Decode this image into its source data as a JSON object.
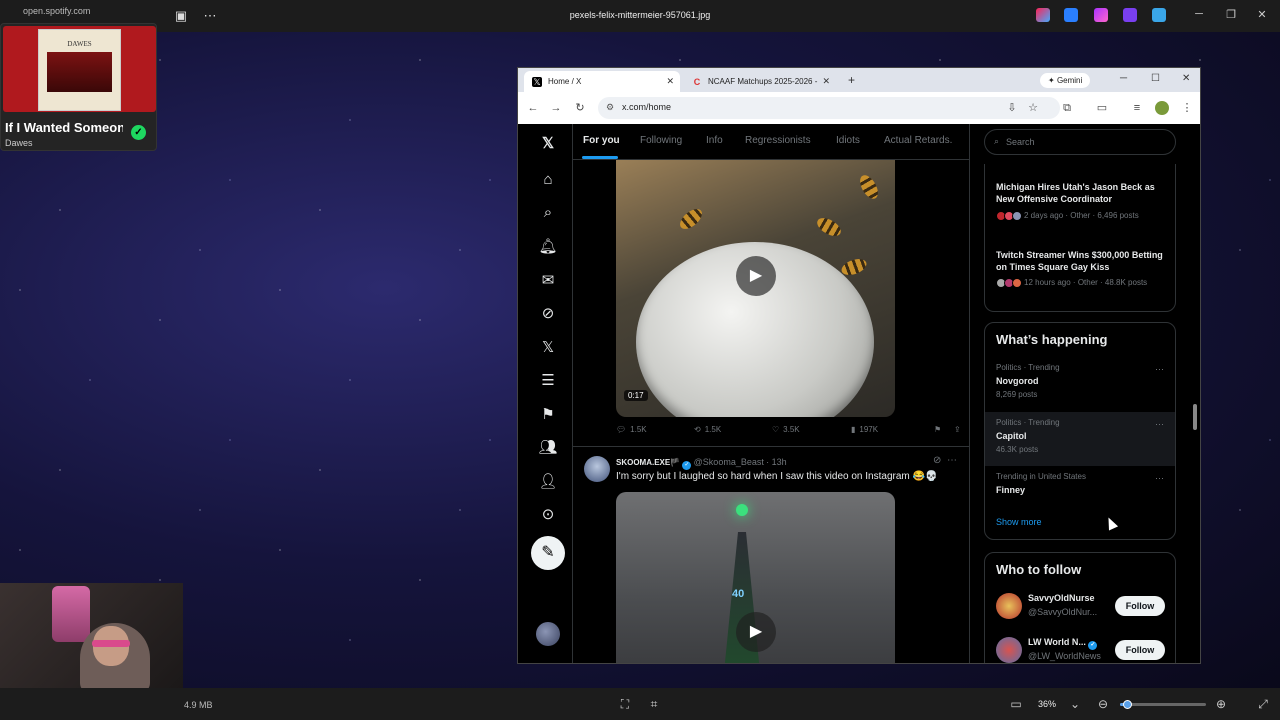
{
  "viewer": {
    "title": "pexels-felix-mittermeier-957061.jpg",
    "file_size": "4.9 MB",
    "zoom": "36%",
    "zoom_level": 0.08
  },
  "spotify": {
    "source": "open.spotify.com",
    "album_band_text": "DAWES",
    "song": "If I Wanted Someone",
    "artist": "Dawes",
    "saved_icon": "check-icon"
  },
  "browser": {
    "tabs": [
      {
        "label": "Home / X",
        "favicon": "x-logo"
      },
      {
        "label": "NCAAF Matchups 2025-2026 -",
        "favicon": "c-logo"
      }
    ],
    "gemini_label": "Gemini",
    "url": "x.com/home"
  },
  "x": {
    "feed_tabs": [
      "For you",
      "Following",
      "Info",
      "Regressionists",
      "Idiots",
      "Actual Retards."
    ],
    "post1": {
      "duration": "0:17",
      "replies": "1.5K",
      "reposts": "1.5K",
      "likes": "3.5K",
      "views": "197K"
    },
    "post2": {
      "name": "SKOOMA.EXE🏴",
      "handle": "@Skooma_Beast",
      "time": "13h",
      "text": "I'm sorry but I laughed so hard when I saw this video on Instagram 😂💀",
      "media_overlay": "40"
    },
    "search_placeholder": "Search",
    "news": [
      {
        "title": "Michigan Hires Utah's Jason Beck as New Offensive Coordinator",
        "meta": "2 days ago · Other · 6,496 posts"
      },
      {
        "title": "Twitch Streamer Wins $300,000 Betting on Times Square Gay Kiss",
        "meta": "12 hours ago · Other · 48.8K posts"
      }
    ],
    "whats_happening": {
      "title": "What’s happening",
      "trends": [
        {
          "category": "Politics · Trending",
          "name": "Novgorod",
          "posts": "8,269 posts"
        },
        {
          "category": "Politics · Trending",
          "name": "Capitol",
          "posts": "46.3K posts"
        },
        {
          "category": "Trending in United States",
          "name": "Finney",
          "posts": ""
        }
      ],
      "show_more": "Show more"
    },
    "who_to_follow": {
      "title": "Who to follow",
      "accounts": [
        {
          "name": "SavvyOldNurse",
          "handle": "@SavvyOldNur...",
          "button": "Follow"
        },
        {
          "name": "LW World N...",
          "handle": "@LW_WorldNews",
          "button": "Follow"
        }
      ]
    }
  }
}
